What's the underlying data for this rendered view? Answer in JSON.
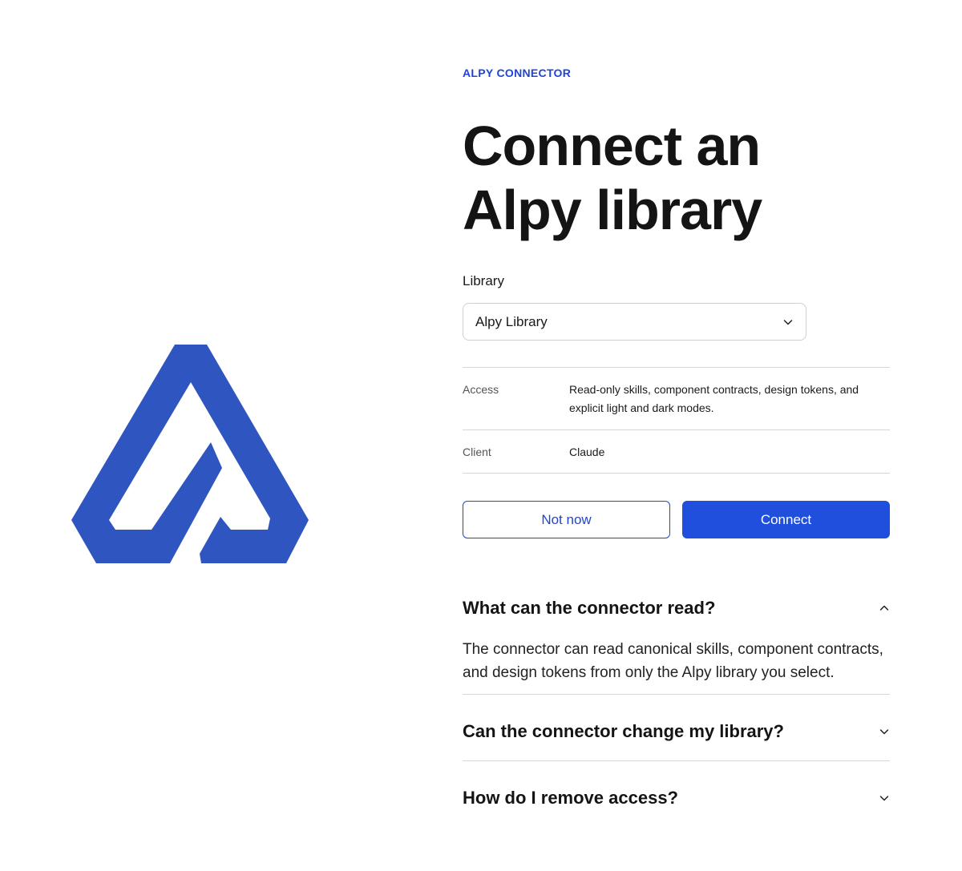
{
  "eyebrow": "ALPY CONNECTOR",
  "title_line1": "Connect an",
  "title_line2": "Alpy library",
  "library": {
    "label": "Library",
    "selected": "Alpy Library",
    "icon": "chevron-down-icon"
  },
  "details": {
    "access_key": "Access",
    "access_value": "Read-only skills, component contracts, design tokens, and explicit light and dark modes.",
    "client_key": "Client",
    "client_value": "Claude"
  },
  "actions": {
    "not_now": "Not now",
    "connect": "Connect"
  },
  "faq": [
    {
      "question": "What can the connector read?",
      "answer": "The connector can read canonical skills, component contracts, and design tokens from only the Alpy library you select.",
      "expanded": true,
      "icon": "chevron-up-icon"
    },
    {
      "question": "Can the connector change my library?",
      "expanded": false,
      "icon": "chevron-down-icon"
    },
    {
      "question": "How do I remove access?",
      "expanded": false,
      "icon": "chevron-down-icon"
    }
  ],
  "colors": {
    "brand": "#2f55c0",
    "accent": "#1f45d6",
    "primary_button": "#1f4fdc"
  }
}
